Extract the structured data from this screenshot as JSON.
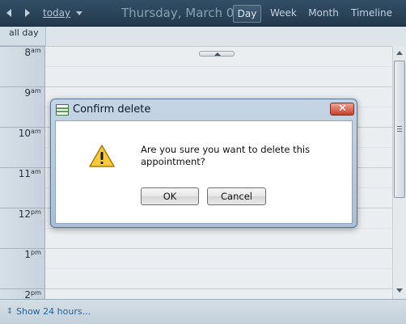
{
  "toolbar": {
    "today_label": "today",
    "date_title": "Thursday, March 01,",
    "views": [
      {
        "label": "Day",
        "active": true
      },
      {
        "label": "Week",
        "active": false
      },
      {
        "label": "Month",
        "active": false
      },
      {
        "label": "Timeline",
        "active": false
      }
    ]
  },
  "all_day": {
    "label": "all day"
  },
  "hours": [
    {
      "num": "8",
      "ampm": "am"
    },
    {
      "num": "9",
      "ampm": "am"
    },
    {
      "num": "10",
      "ampm": "am"
    },
    {
      "num": "11",
      "ampm": "am"
    },
    {
      "num": "12",
      "ampm": "pm"
    },
    {
      "num": "1",
      "ampm": "pm"
    },
    {
      "num": "2",
      "ampm": "pm"
    }
  ],
  "bottom": {
    "show_label": "Show 24 hours..."
  },
  "dialog": {
    "title": "Confirm delete",
    "close_glyph": "✕",
    "message": "Are you sure you want to delete this appointment?",
    "ok_label": "OK",
    "cancel_label": "Cancel"
  },
  "icons": {
    "prev": "chevron-left-icon",
    "next": "chevron-right-icon",
    "dropdown": "chevron-down-icon",
    "warning": "warning-icon",
    "calendar": "calendar-icon",
    "expand": "expand-icon"
  },
  "colors": {
    "toolbar_bg": "#1d3347",
    "gutter_bg": "#cfd9e3",
    "dialog_frame": "#a9bfd6",
    "close_red": "#c8412d",
    "link_blue": "#1f5f95"
  }
}
